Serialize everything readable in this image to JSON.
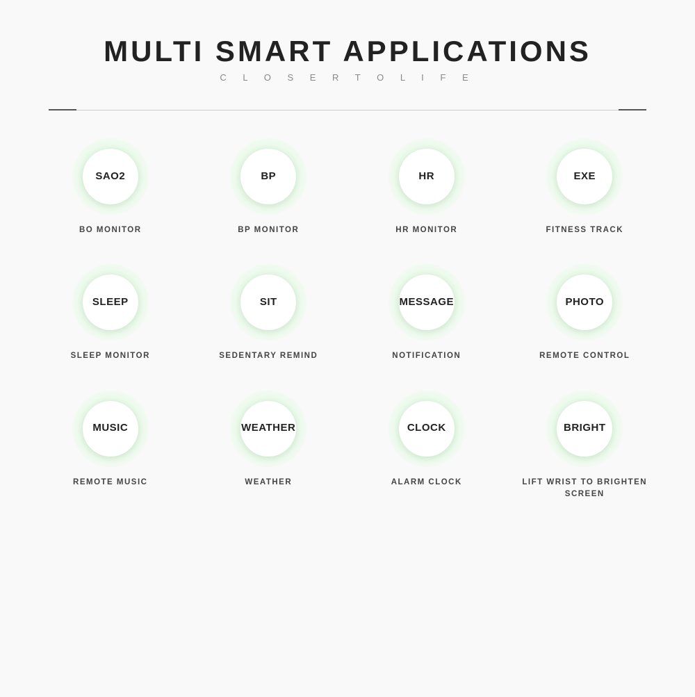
{
  "header": {
    "title": "MULTI SMART APPLICATIONS",
    "subtitle": "C L O S E R   T O   L I F E"
  },
  "apps": [
    {
      "id": "sao2",
      "circle_text": "SAO2",
      "label": "BO MONITOR"
    },
    {
      "id": "bp",
      "circle_text": "BP",
      "label": "BP MONITOR"
    },
    {
      "id": "hr",
      "circle_text": "HR",
      "label": "HR MONITOR"
    },
    {
      "id": "exe",
      "circle_text": "EXE",
      "label": "FITNESS TRACK"
    },
    {
      "id": "sleep",
      "circle_text": "SLEEP",
      "label": "SLEEP MONITOR"
    },
    {
      "id": "sit",
      "circle_text": "SIT",
      "label": "SEDENTARY REMIND"
    },
    {
      "id": "message",
      "circle_text": "MESSAGE",
      "label": "NOTIFICATION"
    },
    {
      "id": "photo",
      "circle_text": "PHOTO",
      "label": "REMOTE CONTROL"
    },
    {
      "id": "music",
      "circle_text": "MUSIC",
      "label": "REMOTE MUSIC"
    },
    {
      "id": "weather",
      "circle_text": "WEATHER",
      "label": "WEATHER"
    },
    {
      "id": "clock",
      "circle_text": "CLOCK",
      "label": "ALARM CLOCK"
    },
    {
      "id": "bright",
      "circle_text": "BRIGHT",
      "label": "LIFT WRIST TO\nBRIGHTEN SCREEN"
    }
  ]
}
